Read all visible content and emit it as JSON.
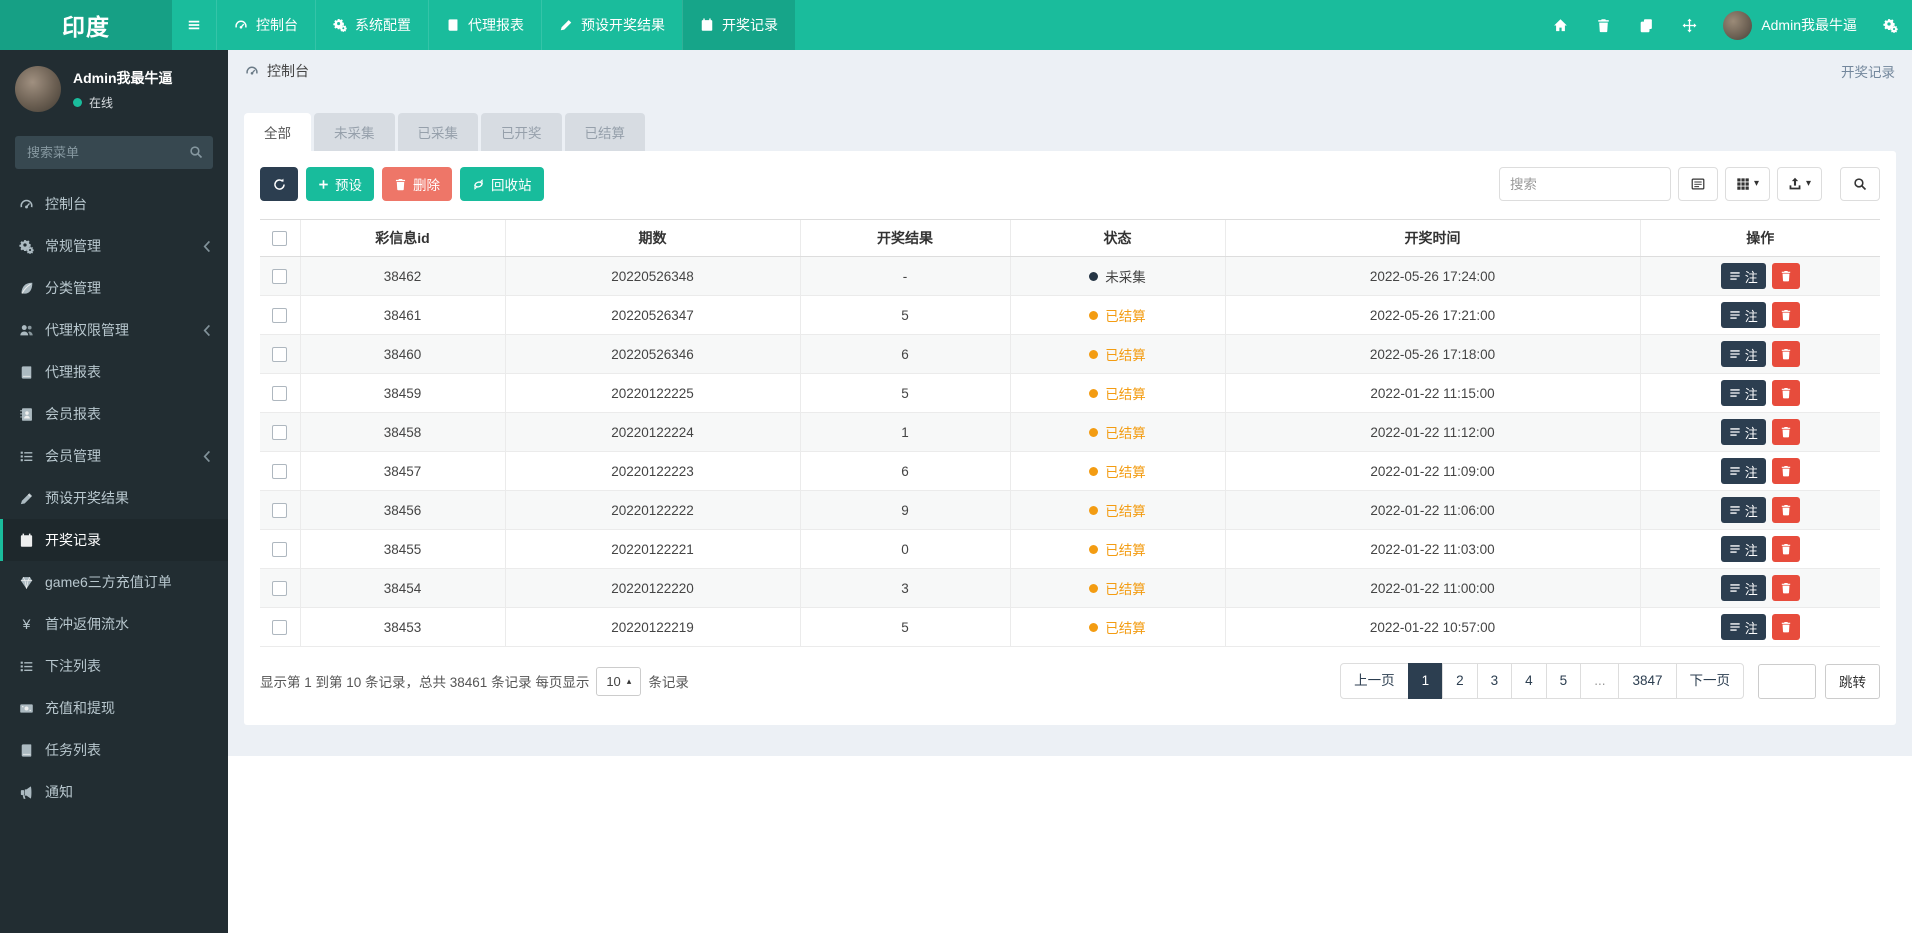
{
  "app": {
    "brand": "印度"
  },
  "navbar": {
    "items": [
      {
        "icon": "gauge",
        "label": "控制台"
      },
      {
        "icon": "cogs",
        "label": "系统配置"
      },
      {
        "icon": "book",
        "label": "代理报表"
      },
      {
        "icon": "pen",
        "label": "预设开奖结果"
      },
      {
        "icon": "calendar",
        "label": "开奖记录",
        "active": true
      }
    ],
    "right_icons": [
      "home",
      "trash",
      "files",
      "expand"
    ],
    "settings_icon": "cogs",
    "user": {
      "name": "Admin我最牛逼"
    }
  },
  "sidebar": {
    "user": {
      "name": "Admin我最牛逼",
      "status": "在线"
    },
    "search_placeholder": "搜索菜单",
    "items": [
      {
        "icon": "gauge",
        "label": "控制台"
      },
      {
        "icon": "cogs",
        "label": "常规管理",
        "chevron": true
      },
      {
        "icon": "leaf",
        "label": "分类管理"
      },
      {
        "icon": "users",
        "label": "代理权限管理",
        "chevron": true
      },
      {
        "icon": "book",
        "label": "代理报表"
      },
      {
        "icon": "idbook",
        "label": "会员报表"
      },
      {
        "icon": "list",
        "label": "会员管理",
        "chevron": true
      },
      {
        "icon": "pen",
        "label": "预设开奖结果"
      },
      {
        "icon": "calendar",
        "label": "开奖记录",
        "active": true
      },
      {
        "icon": "gem",
        "label": "game6三方充值订单"
      },
      {
        "icon": "yen",
        "label": "首冲返佣流水"
      },
      {
        "icon": "list",
        "label": "下注列表"
      },
      {
        "icon": "money",
        "label": "充值和提现"
      },
      {
        "icon": "book",
        "label": "任务列表"
      },
      {
        "icon": "bullhorn",
        "label": "通知"
      }
    ]
  },
  "breadcrumb": {
    "left": "控制台",
    "right": "开奖记录"
  },
  "tabs": [
    {
      "label": "全部",
      "active": true
    },
    {
      "label": "未采集"
    },
    {
      "label": "已采集"
    },
    {
      "label": "已开奖"
    },
    {
      "label": "已结算"
    }
  ],
  "toolbar": {
    "preset_label": "预设",
    "delete_label": "删除",
    "recycle_label": "回收站",
    "search_placeholder": "搜索"
  },
  "table": {
    "columns": [
      "彩信息id",
      "期数",
      "开奖结果",
      "状态",
      "开奖时间",
      "操作"
    ],
    "note_label": "注",
    "rows": [
      {
        "id": "38462",
        "period": "20220526348",
        "result": "-",
        "status": "未采集",
        "status_type": "pending",
        "time": "2022-05-26 17:24:00"
      },
      {
        "id": "38461",
        "period": "20220526347",
        "result": "5",
        "status": "已结算",
        "status_type": "settled",
        "time": "2022-05-26 17:21:00"
      },
      {
        "id": "38460",
        "period": "20220526346",
        "result": "6",
        "status": "已结算",
        "status_type": "settled",
        "time": "2022-05-26 17:18:00"
      },
      {
        "id": "38459",
        "period": "20220122225",
        "result": "5",
        "status": "已结算",
        "status_type": "settled",
        "time": "2022-01-22 11:15:00"
      },
      {
        "id": "38458",
        "period": "20220122224",
        "result": "1",
        "status": "已结算",
        "status_type": "settled",
        "time": "2022-01-22 11:12:00"
      },
      {
        "id": "38457",
        "period": "20220122223",
        "result": "6",
        "status": "已结算",
        "status_type": "settled",
        "time": "2022-01-22 11:09:00"
      },
      {
        "id": "38456",
        "period": "20220122222",
        "result": "9",
        "status": "已结算",
        "status_type": "settled",
        "time": "2022-01-22 11:06:00"
      },
      {
        "id": "38455",
        "period": "20220122221",
        "result": "0",
        "status": "已结算",
        "status_type": "settled",
        "time": "2022-01-22 11:03:00"
      },
      {
        "id": "38454",
        "period": "20220122220",
        "result": "3",
        "status": "已结算",
        "status_type": "settled",
        "time": "2022-01-22 11:00:00"
      },
      {
        "id": "38453",
        "period": "20220122219",
        "result": "5",
        "status": "已结算",
        "status_type": "settled",
        "time": "2022-01-22 10:57:00"
      }
    ]
  },
  "footer": {
    "summary_prefix": "显示第 1 到第 10 条记录，总共 38461 条记录 每页显示",
    "page_size": "10",
    "summary_suffix": "条记录",
    "pagination": {
      "prev": "上一页",
      "pages": [
        "1",
        "2",
        "3",
        "4",
        "5",
        "...",
        "3847"
      ],
      "active": "1",
      "next": "下一页",
      "jump": "跳转"
    }
  },
  "colors": {
    "accent": "#1abc9c",
    "accent_dark": "#16a085",
    "navy": "#2c3e50",
    "danger": "#e74c3c",
    "danger_soft": "#ee7668",
    "warning": "#f39c12",
    "sidebar_bg": "#222d32",
    "content_bg": "#ecf0f5"
  }
}
